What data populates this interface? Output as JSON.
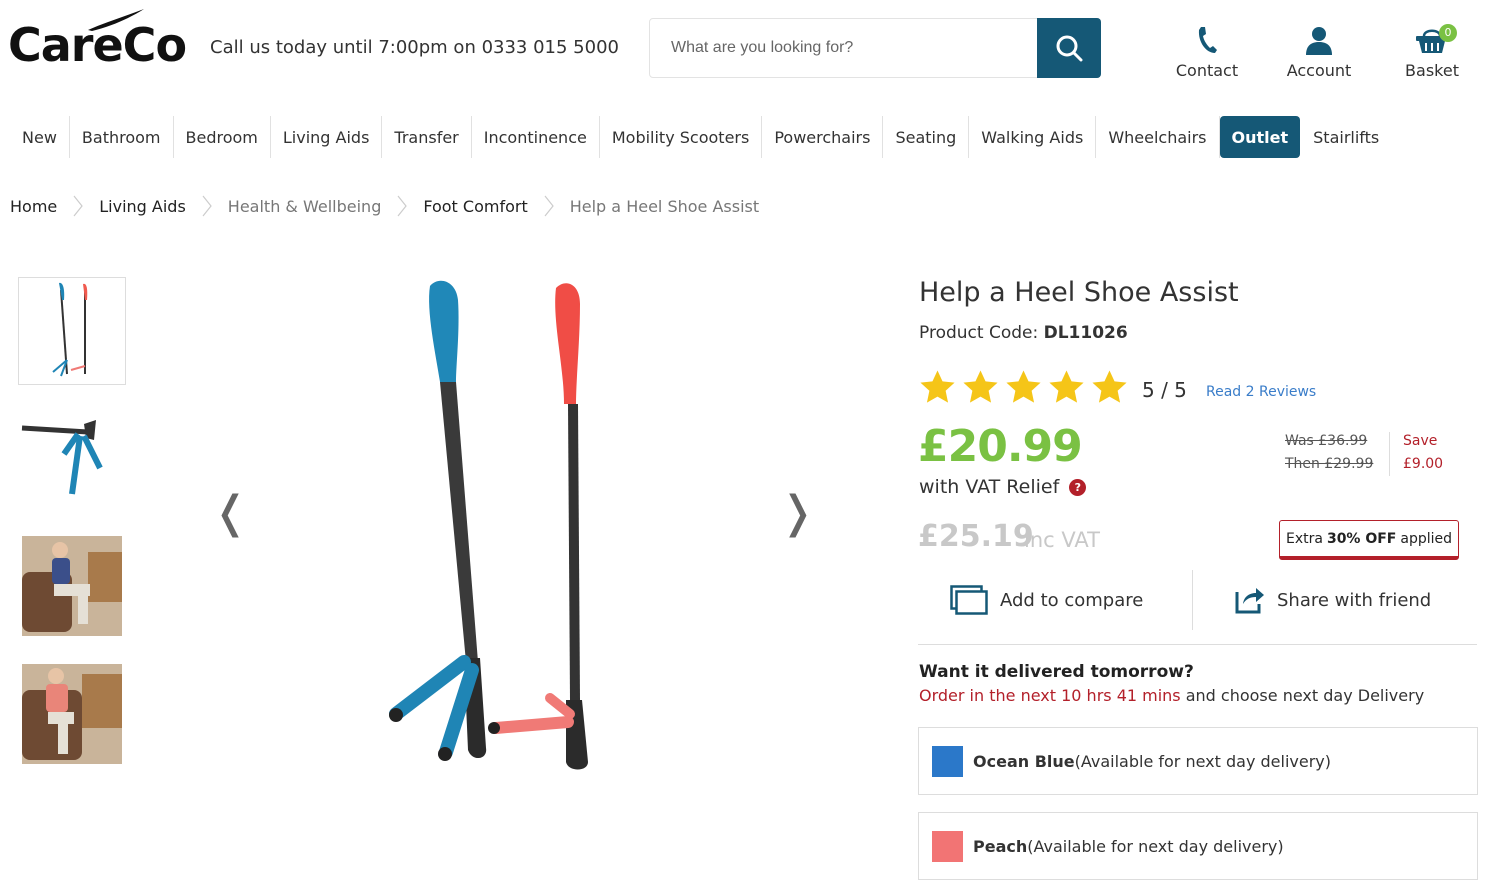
{
  "header": {
    "logo_text": "CareCo",
    "call_us": "Call us today until 7:00pm on 0333 015 5000",
    "search": {
      "placeholder": "What are you looking for?",
      "value": ""
    },
    "links": [
      {
        "label": "Contact",
        "icon": "phone-icon"
      },
      {
        "label": "Account",
        "icon": "user-icon"
      },
      {
        "label": "Basket",
        "icon": "basket-icon"
      }
    ],
    "basket_count": "0"
  },
  "nav": {
    "items": [
      "New",
      "Bathroom",
      "Bedroom",
      "Living Aids",
      "Transfer",
      "Incontinence",
      "Mobility Scooters",
      "Powerchairs",
      "Seating",
      "Walking Aids",
      "Wheelchairs",
      "Outlet",
      "Stairlifts"
    ],
    "active": "Outlet"
  },
  "breadcrumb": [
    "Home",
    "Living Aids",
    "Health & Wellbeing",
    "Foot Comfort",
    "Help a Heel Shoe Assist"
  ],
  "gallery": {
    "prev_arrow": "❬",
    "next_arrow": "❭"
  },
  "product": {
    "title": "Help a Heel Shoe Assist",
    "code_label": "Product Code:",
    "code": "DL11026",
    "rating": "5 / 5",
    "rating_value": 5,
    "reviews_link": "Read 2 Reviews",
    "price": "£20.99",
    "vat_relief": "with VAT Relief",
    "help_icon": "?",
    "was": "Was £36.99",
    "then": "Then £29.99",
    "save_label": "Save",
    "save_amount": "£9.00",
    "inc_price": "£25.19",
    "inc_label": "inc VAT",
    "extra_prefix": "Extra",
    "extra_bold": "30% OFF",
    "extra_suffix": "applied",
    "compare_label": "Add to compare",
    "share_label": "Share with friend",
    "delivery_heading": "Want it delivered tomorrow?",
    "delivery_countdown": "Order in the next 10 hrs 41 mins",
    "delivery_suffix": " and choose next day Delivery",
    "variants": [
      {
        "name": "Ocean Blue",
        "note": "(Available for next day delivery)",
        "color": "#2b78c9"
      },
      {
        "name": "Peach",
        "note": "(Available for next day delivery)",
        "color": "#f27474"
      }
    ]
  },
  "colors": {
    "brand": "#155876",
    "price_green": "#7ac143",
    "sale_red": "#b3202a",
    "star": "#f5c518"
  }
}
